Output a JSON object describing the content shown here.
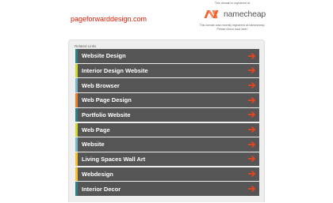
{
  "header": {
    "domain": "pageforwarddesign.com",
    "registered_note": "This domain is registered at",
    "brand_name": "namecheap",
    "brand_note_lines": [
      "This domain was recently registered at Namecheap.",
      "Please check back later!"
    ]
  },
  "related": {
    "title": "Related Links",
    "links": [
      {
        "label": "Website Design",
        "accent": "#2d7f8a"
      },
      {
        "label": "Interior Design Website",
        "accent": "#cfd92b"
      },
      {
        "label": "Web Browser",
        "accent": "#79b6c9"
      },
      {
        "label": "Web Page Design",
        "accent": "#f07d27"
      },
      {
        "label": "Portfolio Website",
        "accent": "#2d7f8a"
      },
      {
        "label": "Web Page",
        "accent": "#cfd92b"
      },
      {
        "label": "Website",
        "accent": "#79b6c9"
      },
      {
        "label": "Living Spaces Wall Art",
        "accent": "#f5c02e"
      },
      {
        "label": "Webdesign",
        "accent": "#f5c02e"
      },
      {
        "label": "Interior Decor",
        "accent": "#2d7f8a"
      }
    ]
  },
  "colors": {
    "domain": "#d81e05",
    "brand": "#f4622a",
    "row_background": "#555555",
    "arrow": "#e8431f"
  },
  "icons": {
    "brand": "namecheap-logo-icon",
    "row_arrow": "arrow-right-icon"
  }
}
